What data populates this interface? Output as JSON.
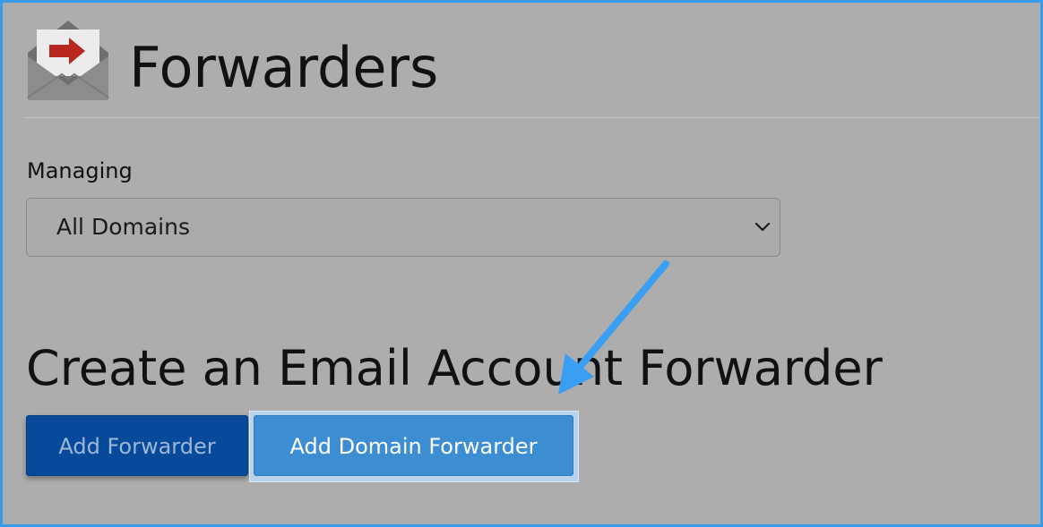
{
  "header": {
    "icon": "email-forward-icon",
    "title": "Forwarders"
  },
  "managing": {
    "label": "Managing",
    "selected_value": "All Domains"
  },
  "section": {
    "title": "Create an Email Account Forwarder"
  },
  "buttons": {
    "add_forwarder": "Add Forwarder",
    "add_domain_forwarder": "Add Domain Forwarder"
  },
  "annotation": {
    "icon": "arrow-pointer-icon",
    "color": "#3a9ff2"
  },
  "colors": {
    "frame_border": "#3a9ce8",
    "background": "#adadad",
    "primary_button": "#074a9a",
    "highlight_button": "#3d8dd3"
  }
}
